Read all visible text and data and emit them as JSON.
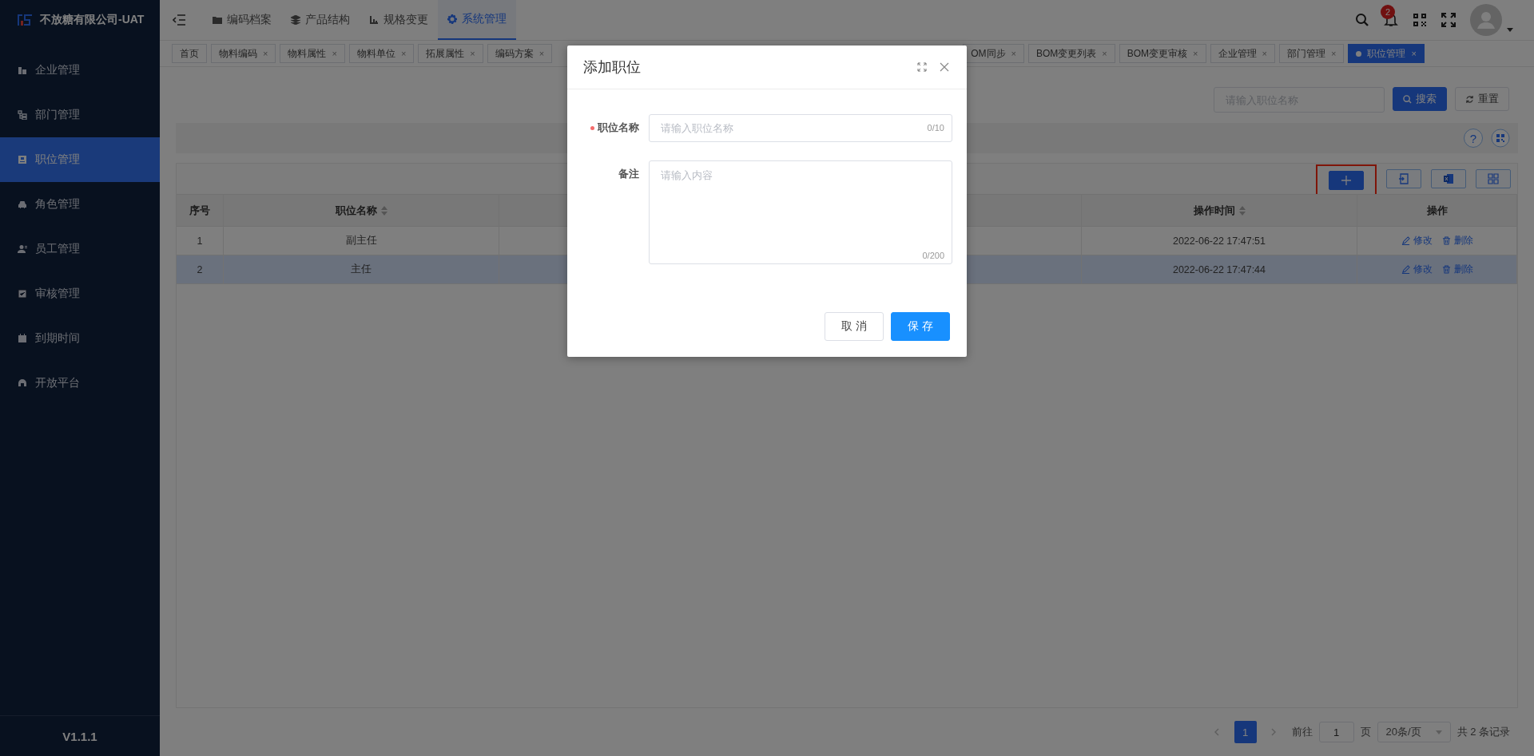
{
  "app": {
    "title": "不放糖有限公司-UAT",
    "version": "V1.1.1"
  },
  "sidebar": {
    "items": [
      {
        "label": "企业管理",
        "selected": false
      },
      {
        "label": "部门管理",
        "selected": false
      },
      {
        "label": "职位管理",
        "selected": true
      },
      {
        "label": "角色管理",
        "selected": false
      },
      {
        "label": "员工管理",
        "selected": false
      },
      {
        "label": "审核管理",
        "selected": false
      },
      {
        "label": "到期时间",
        "selected": false
      },
      {
        "label": "开放平台",
        "selected": false
      }
    ]
  },
  "top_nav": {
    "items": [
      {
        "label": "编码档案",
        "selected": false
      },
      {
        "label": "产品结构",
        "selected": false
      },
      {
        "label": "规格变更",
        "selected": false
      },
      {
        "label": "系统管理",
        "selected": true
      }
    ],
    "notification_count": "2"
  },
  "tabs": {
    "left": [
      {
        "label": "首页",
        "closable": false,
        "selected": false
      },
      {
        "label": "物料编码",
        "closable": true,
        "selected": false
      },
      {
        "label": "物料属性",
        "closable": true,
        "selected": false
      },
      {
        "label": "物料单位",
        "closable": true,
        "selected": false
      },
      {
        "label": "拓展属性",
        "closable": true,
        "selected": false
      },
      {
        "label": "编码方案",
        "closable": true,
        "selected": false
      }
    ],
    "right": [
      {
        "label": "OM同步",
        "closable": true,
        "selected": false
      },
      {
        "label": "BOM变更列表",
        "closable": true,
        "selected": false
      },
      {
        "label": "BOM变更审核",
        "closable": true,
        "selected": false
      },
      {
        "label": "企业管理",
        "closable": true,
        "selected": false
      },
      {
        "label": "部门管理",
        "closable": true,
        "selected": false
      },
      {
        "label": "职位管理",
        "closable": true,
        "selected": true
      }
    ],
    "close_mark": "×"
  },
  "filter": {
    "placeholder": "请输入职位名称",
    "search_button": "搜索",
    "reset_button": "重置"
  },
  "help_mark": "?",
  "table": {
    "columns": [
      {
        "label": "序号",
        "sortable": false
      },
      {
        "label": "职位名称",
        "sortable": true
      },
      {
        "label": "操作时间",
        "sortable": true
      },
      {
        "label": "操作",
        "sortable": false
      }
    ],
    "rows": [
      {
        "index": "1",
        "name": "副主任",
        "time": "2022-06-22 17:47:51",
        "actions": [
          "修改",
          "删除"
        ],
        "selected": false
      },
      {
        "index": "2",
        "name": "主任",
        "time": "2022-06-22 17:47:44",
        "actions": [
          "修改",
          "删除"
        ],
        "selected": true
      }
    ]
  },
  "pagination": {
    "pages": [
      {
        "label": "1",
        "selected": true
      }
    ],
    "goto_label": "前往",
    "goto_value": "1",
    "goto_suffix": "页",
    "page_size": "20条/页",
    "total": "共 2 条记录"
  },
  "dialog": {
    "title": "添加职位",
    "fields": [
      {
        "kind": "input",
        "label": "职位名称",
        "required": true,
        "placeholder": "请输入职位名称",
        "counter": "0/10"
      },
      {
        "kind": "textarea",
        "label": "备注",
        "required": false,
        "placeholder": "请输入内容",
        "counter": "0/200"
      }
    ],
    "buttons": [
      {
        "label": "取 消",
        "primary": false
      },
      {
        "label": "保 存",
        "primary": true
      }
    ]
  }
}
